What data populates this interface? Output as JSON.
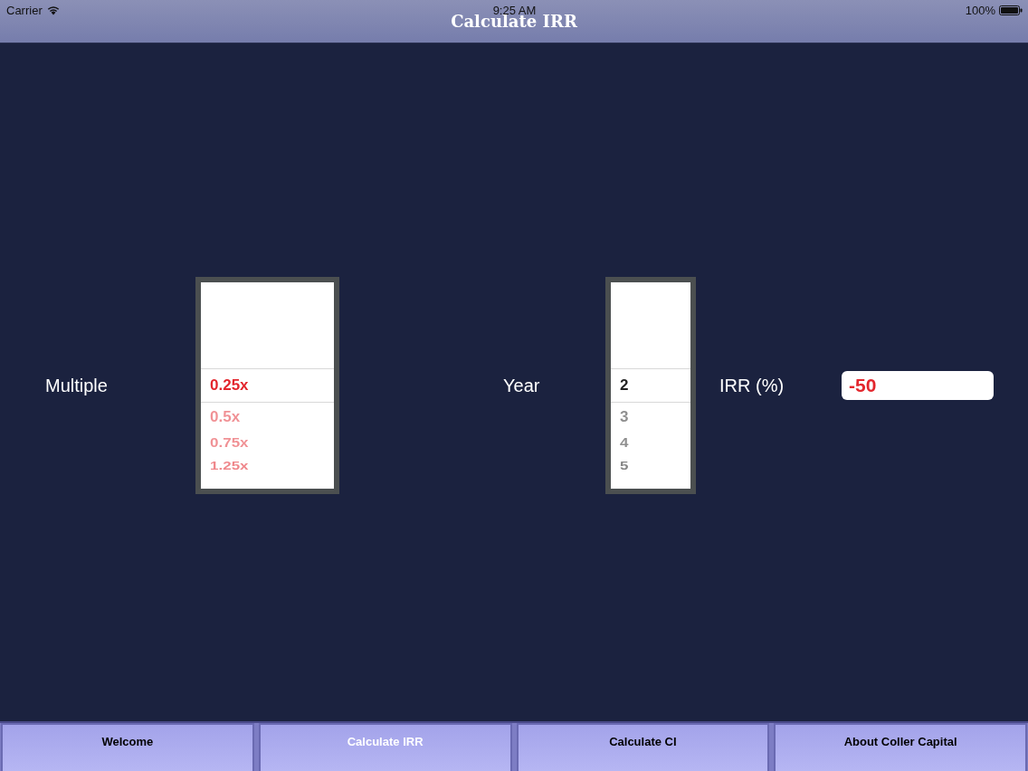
{
  "status_bar": {
    "carrier": "Carrier",
    "time": "9:25 AM",
    "battery": "100%"
  },
  "nav_bar": {
    "title": "Calculate IRR"
  },
  "form": [
    {
      "kind": "label",
      "text": "Multiple"
    },
    {
      "kind": "picker",
      "color": "#e3262d",
      "options": [
        {
          "label": "0.25x",
          "selected": true
        },
        {
          "label": "0.5x",
          "selected": false
        },
        {
          "label": "0.75x",
          "selected": false
        },
        {
          "label": "1.25x",
          "selected": false
        }
      ]
    },
    {
      "kind": "label",
      "text": "Year"
    },
    {
      "kind": "picker",
      "color": "#222222",
      "options": [
        {
          "label": "2",
          "selected": true
        },
        {
          "label": "3",
          "selected": false
        },
        {
          "label": "4",
          "selected": false
        },
        {
          "label": "5",
          "selected": false
        }
      ]
    },
    {
      "kind": "label",
      "text": "IRR (%)"
    },
    {
      "kind": "output",
      "value": "-50"
    }
  ],
  "tabs": [
    {
      "label": "Welcome",
      "selected": false
    },
    {
      "label": "Calculate IRR",
      "selected": true
    },
    {
      "label": "Calculate CI",
      "selected": false
    },
    {
      "label": "About Coller Capital",
      "selected": false
    }
  ]
}
